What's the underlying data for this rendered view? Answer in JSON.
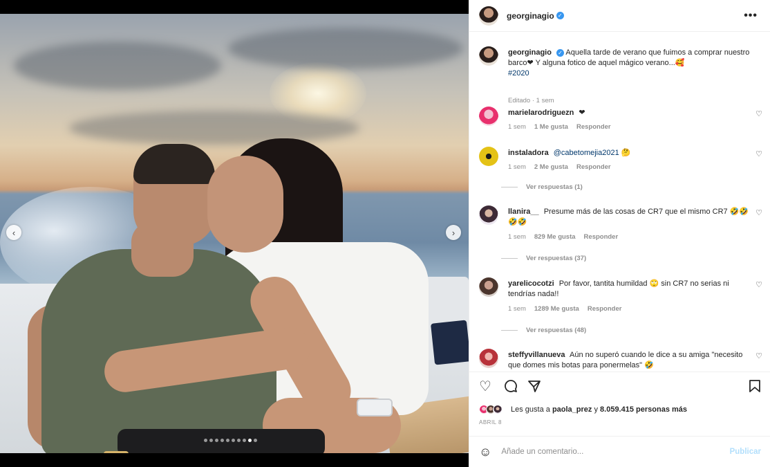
{
  "post": {
    "username": "georginagio",
    "more_label": "•••",
    "caption_text": "Aquella tarde de verano que fuimos a comprar nuestro barco❤ Y alguna fotico de aquel mágico verano...🥰",
    "caption_hashtag": "#2020",
    "caption_meta": "Editado · 1 sem"
  },
  "carousel": {
    "prev": "‹",
    "next": "›",
    "dot_count": 10,
    "active_dot": 8
  },
  "comments": [
    {
      "username": "marielarodriguezn",
      "text": "❤",
      "time": "1 sem",
      "likes": "1 Me gusta",
      "reply": "Responder",
      "replies": ""
    },
    {
      "username": "instaladora",
      "mention": "@cabetomejia2021",
      "text": " 🤔",
      "time": "1 sem",
      "likes": "2 Me gusta",
      "reply": "Responder",
      "replies": "Ver respuestas (1)"
    },
    {
      "username": "llanira__",
      "text": "Presume más de las cosas de CR7 que el mismo CR7 🤣🤣🤣🤣",
      "time": "1 sem",
      "likes": "829 Me gusta",
      "reply": "Responder",
      "replies": "Ver respuestas (37)"
    },
    {
      "username": "yarelicocotzi",
      "text": "Por favor, tantita humildad 🙄 sin CR7 no serias ni tendrías nada!!",
      "time": "1 sem",
      "likes": "1289 Me gusta",
      "reply": "Responder",
      "replies": "Ver respuestas (48)"
    },
    {
      "username": "steffyvillanueva",
      "text": "Aún no superó cuando le dice a su amiga \"necesito que domes mis botas para ponermelas\" 🤣",
      "time": "",
      "likes": "",
      "reply": "",
      "replies": ""
    }
  ],
  "likes": {
    "prefix": "Les gusta a ",
    "user": "paola_prez",
    "middle": " y ",
    "count": "8.059.415 personas más"
  },
  "date": "ABRIL 8",
  "composer": {
    "placeholder": "Añade un comentario...",
    "publish": "Publicar"
  },
  "icons": {
    "heart": "heart-icon",
    "comment": "comment-icon",
    "share": "share-icon",
    "save": "bookmark-icon",
    "emoji": "emoji-icon",
    "verified": "verified-badge-icon"
  },
  "colors": {
    "link": "#00376b",
    "verified": "#3897f0",
    "publish": "#b2dffc"
  }
}
